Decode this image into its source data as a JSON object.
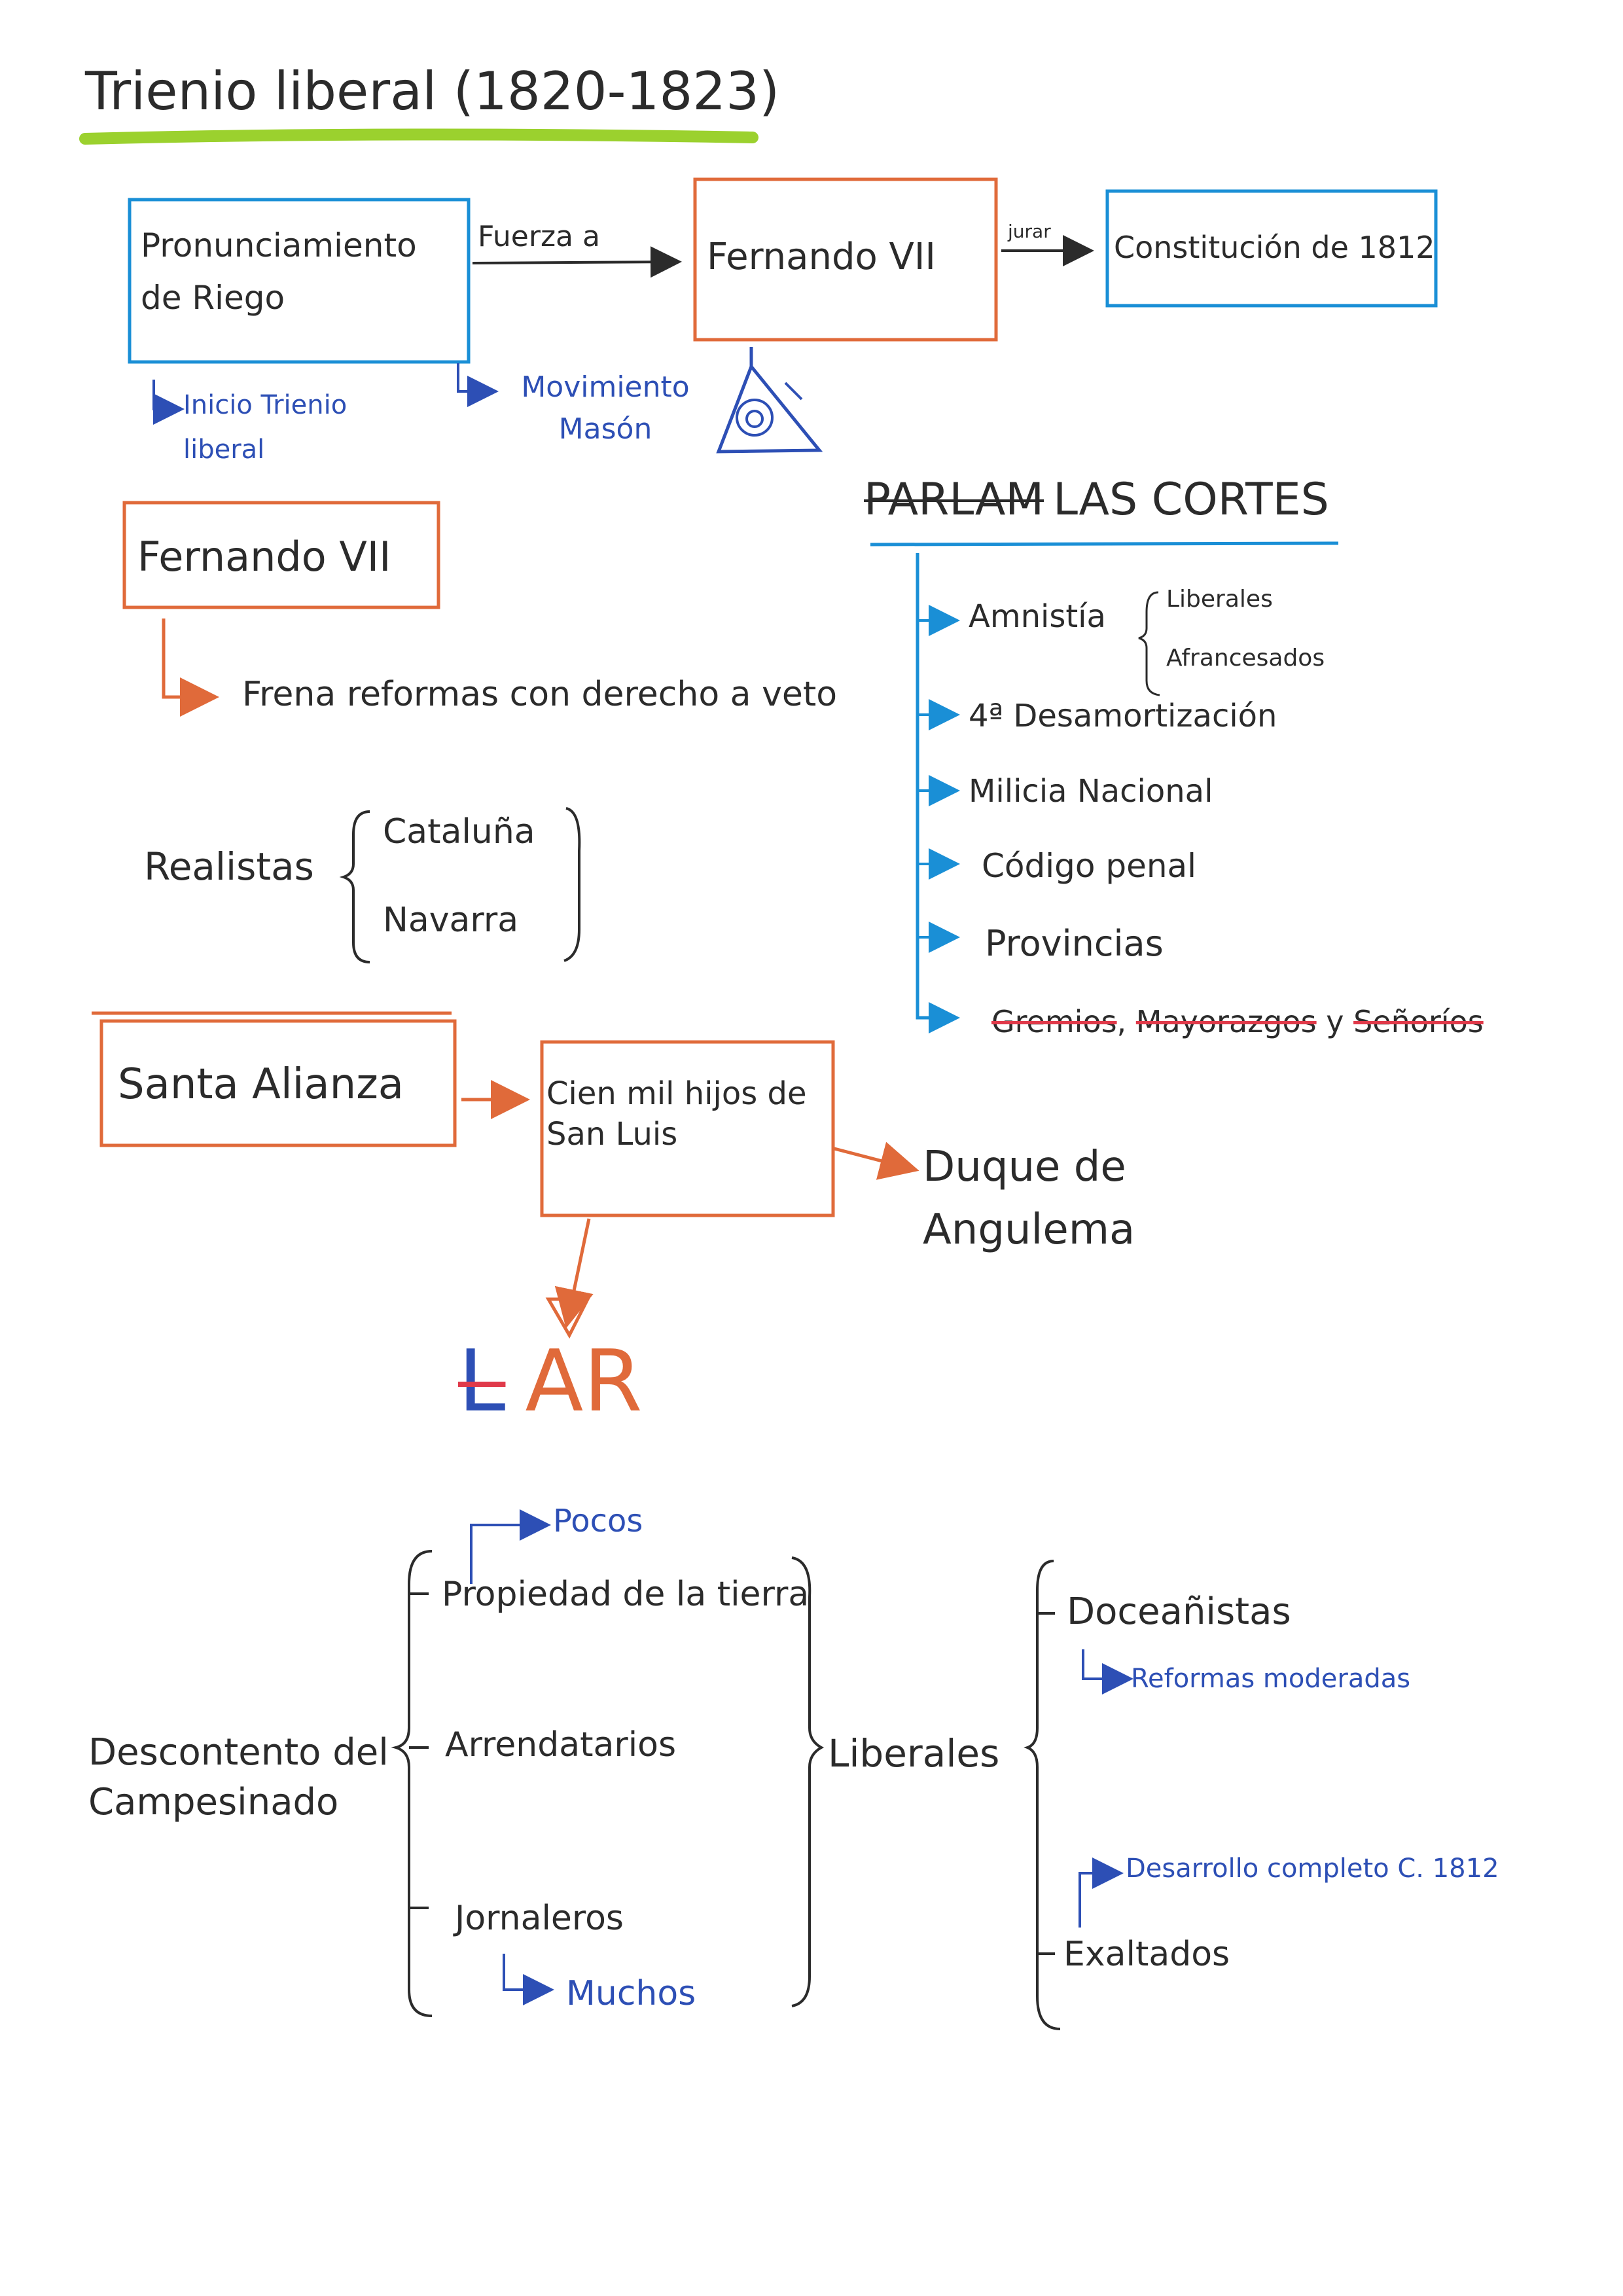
{
  "title": "Trienio liberal (1820-1823)",
  "colors": {
    "ink": "#2b2b2b",
    "blue": "#2d4fb5",
    "cyan": "#1a8fd6",
    "orange": "#e06a3a",
    "green": "#9bd12e",
    "red": "#e03a4a"
  },
  "flow1": {
    "riego": "Pronunciamiento de Riego",
    "fuerza": "Fuerza a",
    "fernando": "Fernando VII",
    "jurar": "jurar",
    "constitucion": "Constitución de 1812",
    "inicio": "Inicio Trienio liberal",
    "movimiento": "Movimiento Masón",
    "icon": "eye-triangle-icon"
  },
  "cortes": {
    "struck": "PARLAM",
    "heading": "LAS CORTES",
    "items": [
      "Amnistía",
      "4ª Desamortización",
      "Milicia Nacional",
      "Código penal",
      "Provincias"
    ],
    "amnistia_sub": [
      "Liberales",
      "Afrancesados"
    ],
    "abolished": [
      "Gremios",
      "Mayorazgos",
      "Señoríos"
    ],
    "abolished_sep": [
      ",",
      " y "
    ]
  },
  "fernando2": {
    "box": "Fernando VII",
    "note": "Frena reformas con derecho a veto"
  },
  "realistas": {
    "label": "Realistas",
    "items": [
      "Cataluña",
      "Navarra"
    ]
  },
  "alianza": {
    "box": "Santa Alianza",
    "cien": "Cien mil hijos de San Luis",
    "duque": "Duque de Angulema",
    "struck_letter": "L",
    "result": "AR"
  },
  "campesinado": {
    "label": "Descontento del Campesinado",
    "items": [
      "Propiedad de la tierra",
      "Arrendatarios",
      "Jornaleros"
    ],
    "pocos": "Pocos",
    "muchos": "Muchos",
    "liberales": "Liberales",
    "doceanistas": "Doceañistas",
    "reformas": "Reformas moderadas",
    "desarrollo": "Desarrollo completo C. 1812",
    "exaltados": "Exaltados"
  }
}
